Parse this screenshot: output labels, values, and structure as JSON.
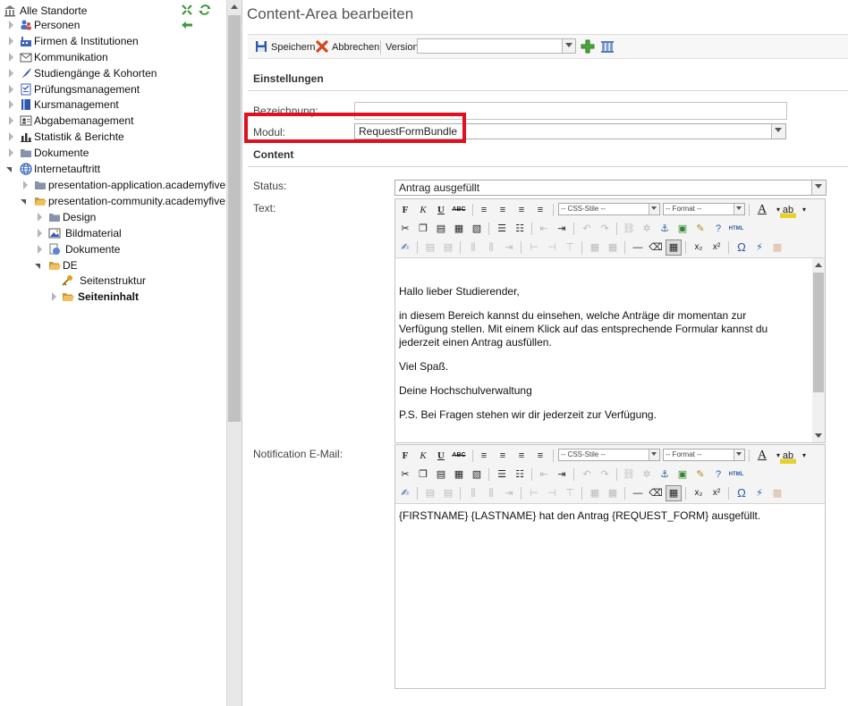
{
  "tree": {
    "root_label": "Alle Standorte",
    "items": [
      {
        "label": "Personen"
      },
      {
        "label": "Firmen & Institutionen"
      },
      {
        "label": "Kommunikation"
      },
      {
        "label": "Studiengänge & Kohorten"
      },
      {
        "label": "Prüfungsmanagement"
      },
      {
        "label": "Kursmanagement"
      },
      {
        "label": "Abgabemanagement"
      },
      {
        "label": "Statistik & Berichte"
      },
      {
        "label": "Dokumente"
      },
      {
        "label": "Internetauftritt"
      },
      {
        "label": "presentation-application.academyfive"
      },
      {
        "label": "presentation-community.academyfive"
      },
      {
        "label": "Design"
      },
      {
        "label": "Bildmaterial"
      },
      {
        "label": "Dokumente"
      },
      {
        "label": "DE"
      },
      {
        "label": "Seitenstruktur"
      },
      {
        "label": "Seiteninhalt"
      }
    ]
  },
  "main": {
    "title": "Content-Area bearbeiten",
    "toolbar": {
      "save_label": "Speichern",
      "cancel_label": "Abbrechen",
      "version_label": "Version",
      "version_value": ""
    },
    "settings": {
      "heading": "Einstellungen",
      "bezeichnung_label": "Bezeichnung:",
      "bezeichnung_value": "",
      "modul_label": "Modul:",
      "modul_value": "RequestFormBundle"
    },
    "content": {
      "heading": "Content",
      "status_label": "Status:",
      "status_value": "Antrag ausgefüllt",
      "text_label": "Text:",
      "notification_label": "Notification E-Mail:"
    },
    "editor": {
      "css_styles": "-- CSS-Stile --",
      "format": "-- Format --",
      "html_label": "HTML"
    },
    "text_editor": {
      "paragraphs": [
        "Hallo lieber Studierender,",
        "in diesem Bereich kannst du einsehen, welche Anträge dir momentan zur Verfügung stellen. Mit einem Klick auf das entsprechende Formular kannst du jederzeit einen Antrag ausfüllen.",
        "Viel Spaß.",
        "Deine Hochschulverwaltung",
        "P.S. Bei Fragen stehen wir dir jederzeit zur Verfügung."
      ]
    },
    "notification_editor": {
      "text": "{FIRSTNAME} {LASTNAME} hat den Antrag {REQUEST_FORM} ausgefüllt."
    }
  },
  "colors": {
    "highlight": "#e0101e",
    "folder": "#f0c060"
  }
}
